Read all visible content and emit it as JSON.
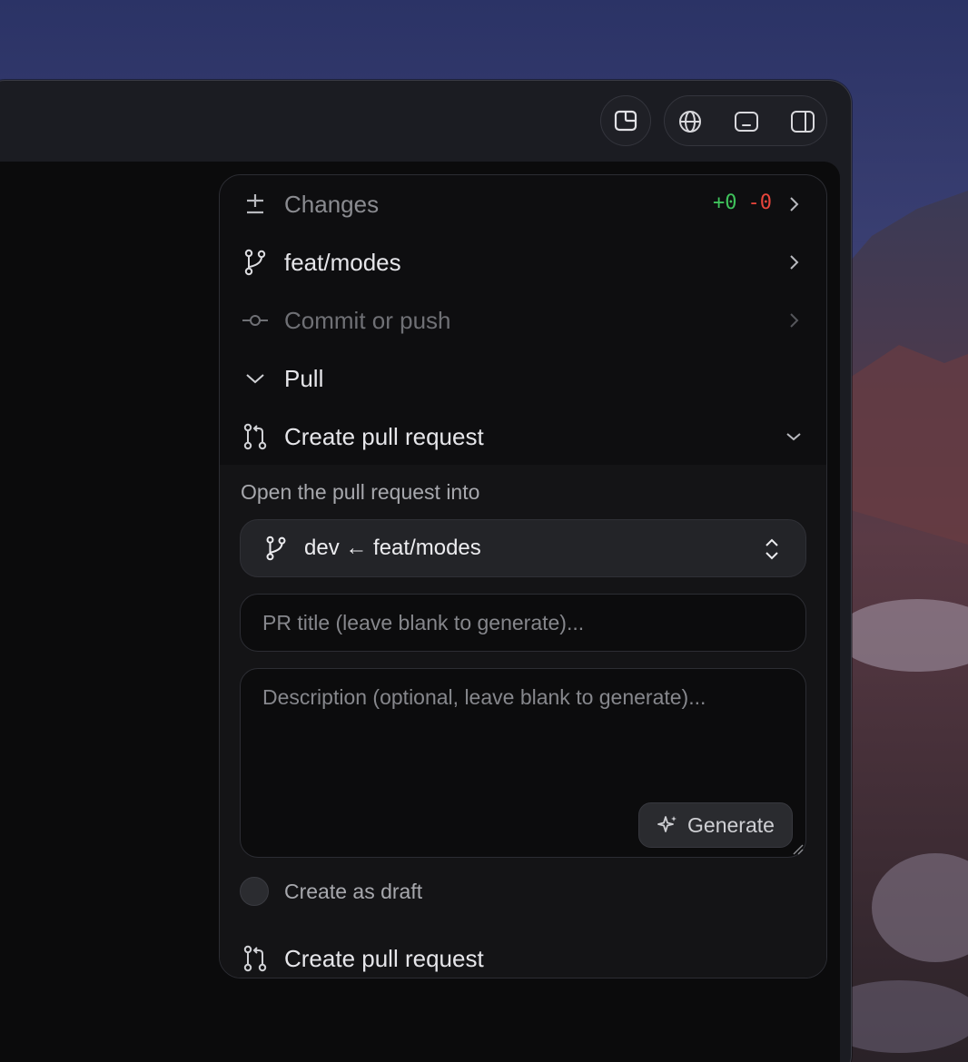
{
  "toolbar": {
    "buttons": [
      {
        "icon": "panel-layout-icon"
      },
      {
        "icon": "globe-icon"
      },
      {
        "icon": "terminal-panel-icon"
      },
      {
        "icon": "sidebar-right-icon"
      }
    ]
  },
  "git_panel": {
    "changes": {
      "label": "Changes",
      "additions": "+0",
      "deletions": "-0"
    },
    "branch": {
      "label": "feat/modes"
    },
    "commit": {
      "label": "Commit or push"
    },
    "pull": {
      "label": "Pull"
    },
    "create_pr_header": {
      "label": "Create pull request"
    },
    "pr_form": {
      "into_label": "Open the pull request into",
      "branch_target": "dev ← feat/modes",
      "title_placeholder": "PR title (leave blank to generate)...",
      "description_placeholder": "Description (optional, leave blank to generate)...",
      "generate_label": "Generate",
      "draft_label": "Create as draft",
      "submit_label": "Create pull request"
    }
  },
  "colors": {
    "additions": "#3fc25b",
    "deletions": "#e8453c",
    "panel_bg": "#0e0e10"
  }
}
